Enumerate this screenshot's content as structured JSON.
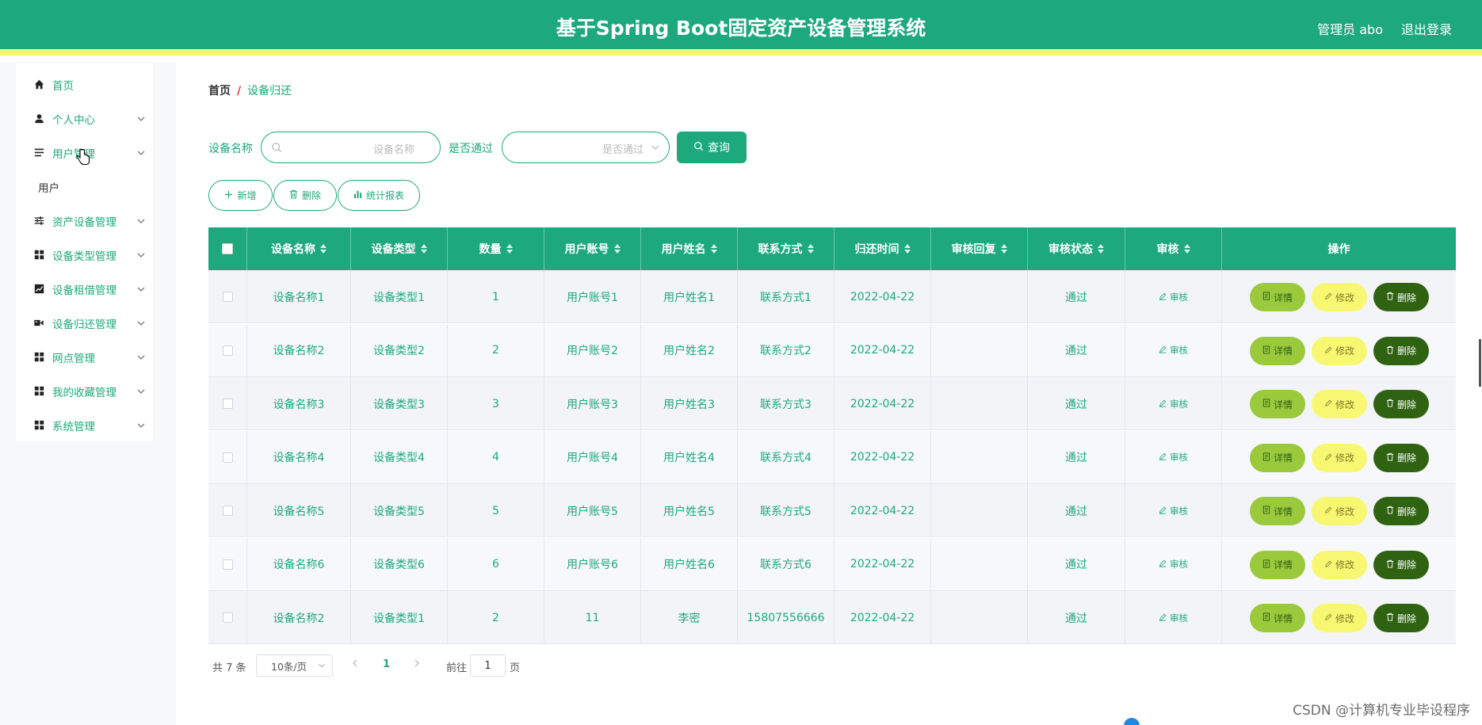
{
  "header": {
    "title": "基于Spring Boot固定资产设备管理系统",
    "admin": "管理员 abo",
    "logout": "退出登录",
    "accent": "#1da97c",
    "stripe": "#f0fa6e"
  },
  "sidebar": {
    "items": [
      {
        "label": "首页",
        "icon": "home-icon",
        "chevron": false
      },
      {
        "label": "个人中心",
        "icon": "user-icon",
        "chevron": true
      },
      {
        "label": "用户管理",
        "icon": "list-icon",
        "chevron": true
      },
      {
        "label": "用户",
        "icon": "",
        "chevron": false
      },
      {
        "label": "资产设备管理",
        "icon": "sliders-icon",
        "chevron": true
      },
      {
        "label": "设备类型管理",
        "icon": "grid-icon",
        "chevron": true
      },
      {
        "label": "设备租借管理",
        "icon": "chart-icon",
        "chevron": true
      },
      {
        "label": "设备归还管理",
        "icon": "video-icon",
        "chevron": true
      },
      {
        "label": "网点管理",
        "icon": "grid-icon",
        "chevron": true
      },
      {
        "label": "我的收藏管理",
        "icon": "grid-icon",
        "chevron": true
      },
      {
        "label": "系统管理",
        "icon": "grid-icon",
        "chevron": true
      }
    ]
  },
  "breadcrumb": {
    "home": "首页",
    "separator": "/",
    "current": "设备归还"
  },
  "search": {
    "name_label": "设备名称",
    "name_placeholder": "设备名称",
    "pass_label": "是否通过",
    "pass_placeholder": "是否通过",
    "query_label": "查询"
  },
  "actions": {
    "add": "新增",
    "delete": "删除",
    "report": "统计报表"
  },
  "table": {
    "headers": [
      "设备名称",
      "设备类型",
      "数量",
      "用户账号",
      "用户姓名",
      "联系方式",
      "归还时间",
      "审核回复",
      "审核状态",
      "审核",
      "操作"
    ],
    "rows": [
      {
        "name": "设备名称1",
        "type": "设备类型1",
        "qty": "1",
        "account": "用户账号1",
        "username": "用户姓名1",
        "contact": "联系方式1",
        "time": "2022-04-22",
        "reply": "",
        "status": "通过",
        "audit": "审核"
      },
      {
        "name": "设备名称2",
        "type": "设备类型2",
        "qty": "2",
        "account": "用户账号2",
        "username": "用户姓名2",
        "contact": "联系方式2",
        "time": "2022-04-22",
        "reply": "",
        "status": "通过",
        "audit": "审核"
      },
      {
        "name": "设备名称3",
        "type": "设备类型3",
        "qty": "3",
        "account": "用户账号3",
        "username": "用户姓名3",
        "contact": "联系方式3",
        "time": "2022-04-22",
        "reply": "",
        "status": "通过",
        "audit": "审核"
      },
      {
        "name": "设备名称4",
        "type": "设备类型4",
        "qty": "4",
        "account": "用户账号4",
        "username": "用户姓名4",
        "contact": "联系方式4",
        "time": "2022-04-22",
        "reply": "",
        "status": "通过",
        "audit": "审核"
      },
      {
        "name": "设备名称5",
        "type": "设备类型5",
        "qty": "5",
        "account": "用户账号5",
        "username": "用户姓名5",
        "contact": "联系方式5",
        "time": "2022-04-22",
        "reply": "",
        "status": "通过",
        "audit": "审核"
      },
      {
        "name": "设备名称6",
        "type": "设备类型6",
        "qty": "6",
        "account": "用户账号6",
        "username": "用户姓名6",
        "contact": "联系方式6",
        "time": "2022-04-22",
        "reply": "",
        "status": "通过",
        "audit": "审核"
      },
      {
        "name": "设备名称2",
        "type": "设备类型1",
        "qty": "2",
        "account": "11",
        "username": "李密",
        "contact": "15807556666",
        "time": "2022-04-22",
        "reply": "",
        "status": "通过",
        "audit": "审核"
      }
    ],
    "row_actions": {
      "detail": "详情",
      "edit": "修改",
      "delete": "删除",
      "detail_color": "#9ac93b",
      "edit_color": "#f8f772",
      "delete_color": "#2f6312"
    }
  },
  "pagination": {
    "total": "共 7 条",
    "page_size": "10条/页",
    "current_page": "1",
    "goto_label": "前往",
    "goto_value": "1",
    "goto_suffix": "页"
  },
  "watermark": "CSDN @计算机专业毕设程序"
}
